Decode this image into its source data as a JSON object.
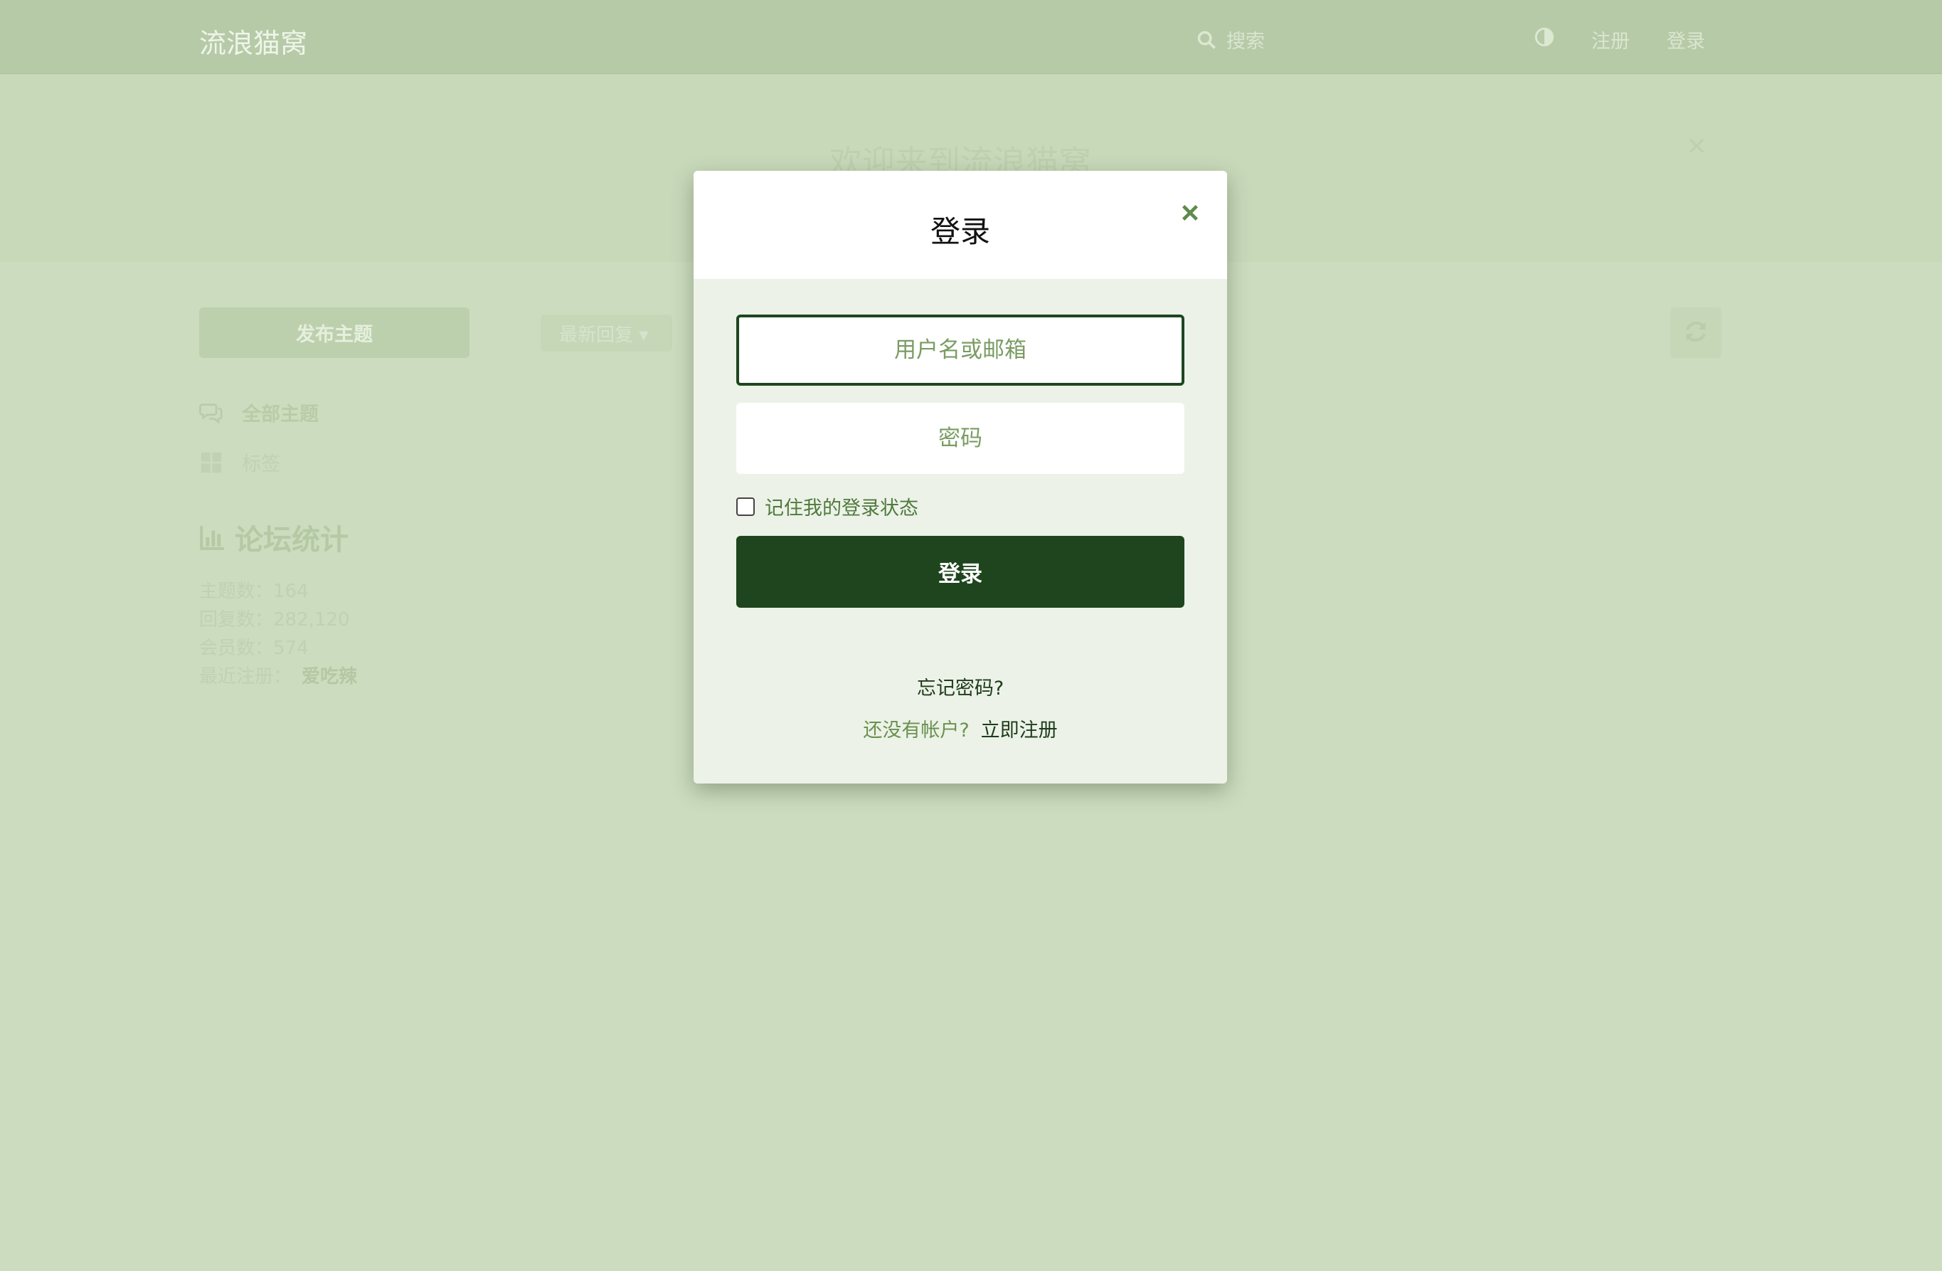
{
  "header": {
    "logo": "流浪猫窝",
    "search_placeholder": "搜索",
    "register": "注册",
    "login": "登录"
  },
  "hero": {
    "title": "欢迎来到流浪猫窝",
    "close": "×"
  },
  "sidebar": {
    "new_topic": "发布主题",
    "all_topics": "全部主题",
    "tags": "标签"
  },
  "toolbar": {
    "sort": "最新回复"
  },
  "stats": {
    "title": "论坛统计",
    "topics": "主题数：164",
    "replies": "回复数：282,120",
    "members": "会员数：574",
    "latest_label": "最近注册：",
    "latest_user": "爱吃辣"
  },
  "modal": {
    "title": "登录",
    "username_placeholder": "用户名或邮箱",
    "password_placeholder": "密码",
    "remember": "记住我的登录状态",
    "submit": "登录",
    "forgot": "忘记密码?",
    "no_account": "还没有帐户?",
    "signup": "立即注册"
  },
  "colors": {
    "accent": "#1f451f",
    "background": "#ccdcbf",
    "header": "#b6caa8"
  }
}
